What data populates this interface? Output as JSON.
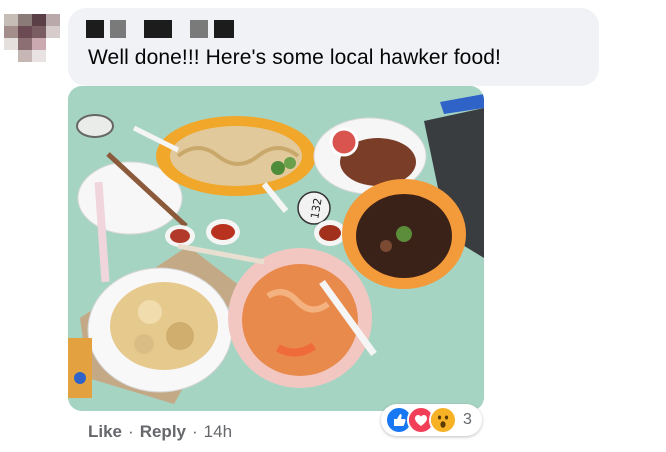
{
  "comment": {
    "text": "Well done!!! Here's some local hawker food!",
    "author_redacted": true
  },
  "photo": {
    "table_number": "132",
    "description_labels": []
  },
  "reactions": {
    "types": [
      "like-icon",
      "love-icon",
      "wow-icon"
    ],
    "count": "3",
    "colors": {
      "like": "#1877f2",
      "love": "#f33e58",
      "wow": "#f7b125"
    }
  },
  "actions": {
    "like": "Like",
    "separator": "·",
    "reply": "Reply",
    "time": "14h"
  },
  "colors": {
    "bubble": "#f0f2f5",
    "secondary_text": "#65676b",
    "table": "#9fd0bf"
  }
}
